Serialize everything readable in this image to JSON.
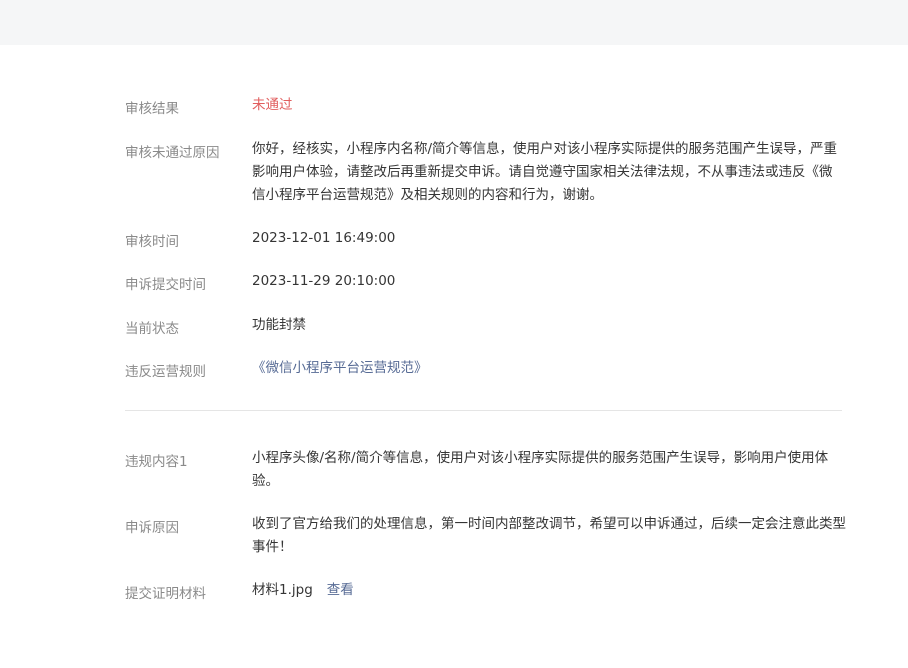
{
  "section1": {
    "result_label": "审核结果",
    "result_value": "未通过",
    "reason_label": "审核未通过原因",
    "reason_value": "你好，经核实，小程序内名称/简介等信息，使用户对该小程序实际提供的服务范围产生误导，严重影响用户体验，请整改后再重新提交申诉。请自觉遵守国家相关法律法规，不从事违法或违反《微信小程序平台运营规范》及相关规则的内容和行为，谢谢。",
    "review_time_label": "审核时间",
    "review_time_value": "2023-12-01 16:49:00",
    "appeal_time_label": "申诉提交时间",
    "appeal_time_value": "2023-11-29 20:10:00",
    "status_label": "当前状态",
    "status_value": "功能封禁",
    "rule_label": "违反运营规则",
    "rule_link": "《微信小程序平台运营规范》"
  },
  "section2": {
    "violation_label": "违规内容1",
    "violation_value": "小程序头像/名称/简介等信息，使用户对该小程序实际提供的服务范围产生误导，影响用户使用体验。",
    "appeal_reason_label": "申诉原因",
    "appeal_reason_value": "收到了官方给我们的处理信息，第一时间内部整改调节，希望可以申诉通过，后续一定会注意此类型事件！",
    "evidence_label": "提交证明材料",
    "evidence_file": "材料1.jpg",
    "evidence_view": "查看"
  },
  "colors": {
    "fail_red": "#e15e5e",
    "link_blue": "#576b95"
  }
}
